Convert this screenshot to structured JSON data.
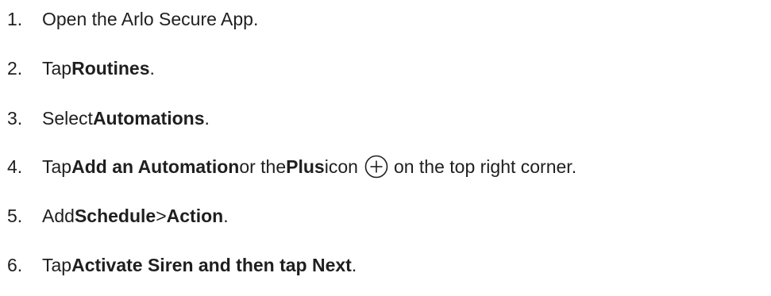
{
  "steps": [
    {
      "number": "1.",
      "parts": [
        "Open the Arlo Secure App."
      ]
    },
    {
      "number": "2.",
      "parts": [
        "Tap ",
        "Routines",
        "."
      ]
    },
    {
      "number": "3.",
      "parts": [
        "Select ",
        "Automations",
        "."
      ]
    },
    {
      "number": "4.",
      "parts": [
        "Tap ",
        "Add an Automation",
        " or the ",
        "Plus",
        " icon",
        "on the top right corner."
      ],
      "icon": "plus-circle-icon"
    },
    {
      "number": "5.",
      "parts": [
        "Add ",
        "Schedule",
        " > ",
        "Action",
        "."
      ]
    },
    {
      "number": "6.",
      "parts": [
        "Tap ",
        "Activate Siren and then tap Next",
        "."
      ]
    }
  ],
  "colors": {
    "text": "#1f1f1f",
    "icon_stroke": "#1f1f1f"
  }
}
